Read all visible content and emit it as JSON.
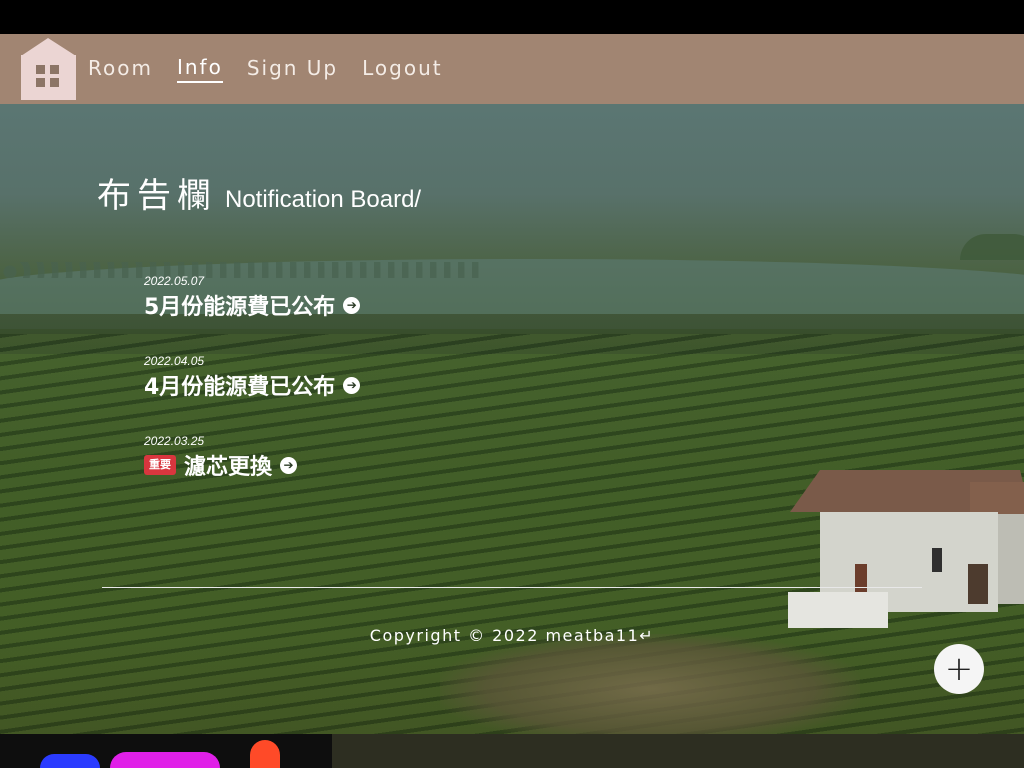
{
  "nav": {
    "items": [
      {
        "label": "Room",
        "active": false
      },
      {
        "label": "Info",
        "active": true
      },
      {
        "label": "Sign Up",
        "active": false
      },
      {
        "label": "Logout",
        "active": false
      }
    ],
    "logo_icon": "house-icon"
  },
  "board": {
    "title_zh": "布告欄",
    "title_en": "Notification Board/"
  },
  "notices": [
    {
      "date": "2022.05.07",
      "title": "5月份能源費已公布",
      "badge": ""
    },
    {
      "date": "2022.04.05",
      "title": "4月份能源費已公布",
      "badge": ""
    },
    {
      "date": "2022.03.25",
      "title": "濾芯更換",
      "badge": "重要"
    }
  ],
  "footer": {
    "copyright": "Copyright © 2022 meatba11↵"
  },
  "fab": {
    "icon": "plus-icon"
  },
  "colors": {
    "navbar": "#a18572",
    "logo": "#ebd5d3",
    "badge": "#d9363e"
  }
}
